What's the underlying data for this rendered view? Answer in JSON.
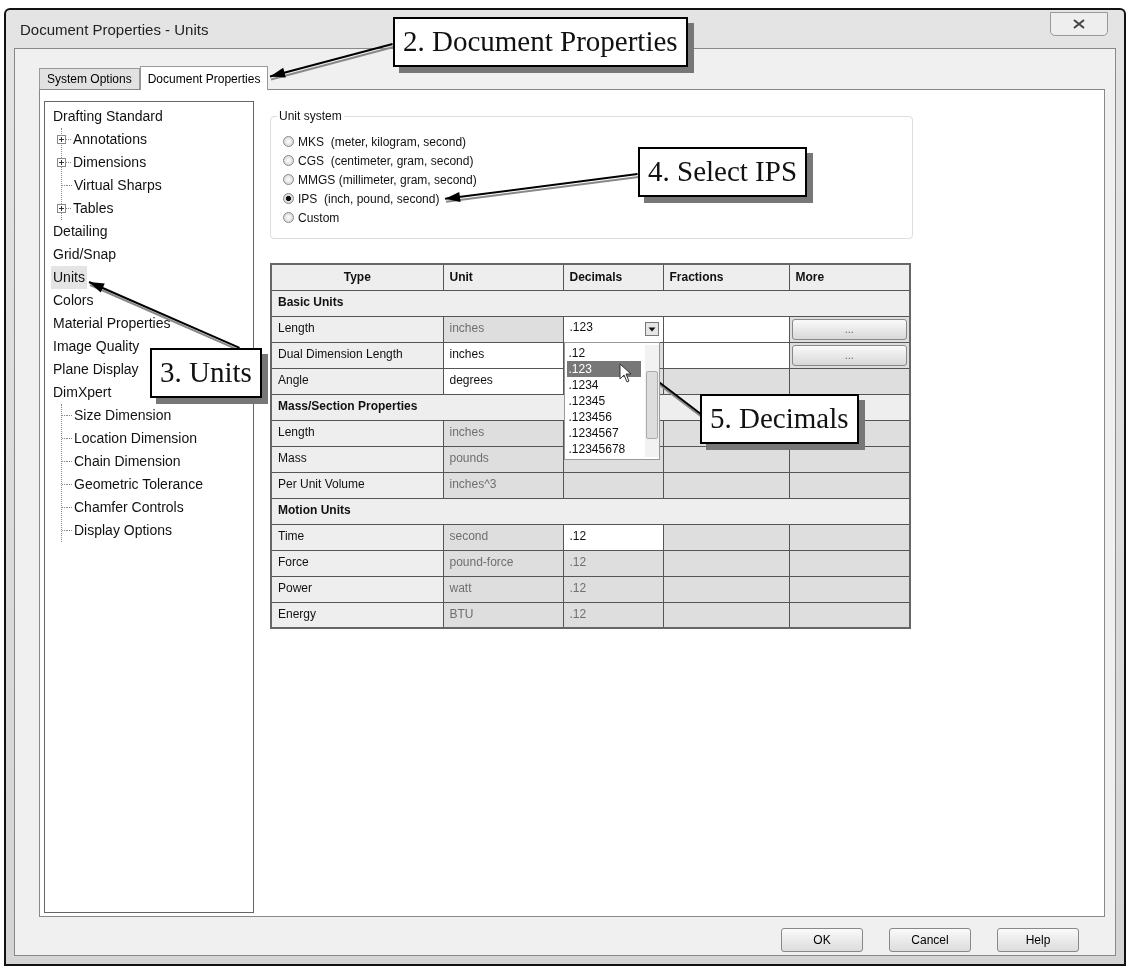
{
  "window": {
    "title": "Document Properties - Units"
  },
  "tabs": [
    {
      "label": "System Options",
      "selected": false
    },
    {
      "label": "Document Properties",
      "selected": true
    }
  ],
  "tree": [
    {
      "label": "Drafting Standard",
      "selected": false,
      "children": [
        {
          "label": "Annotations",
          "expandable": true,
          "selected": false
        },
        {
          "label": "Dimensions",
          "expandable": true,
          "selected": false
        },
        {
          "label": "Virtual Sharps",
          "expandable": false,
          "selected": false
        },
        {
          "label": "Tables",
          "expandable": true,
          "selected": false
        }
      ]
    },
    {
      "label": "Detailing",
      "selected": false
    },
    {
      "label": "Grid/Snap",
      "selected": false
    },
    {
      "label": "Units",
      "selected": true
    },
    {
      "label": "Colors",
      "selected": false
    },
    {
      "label": "Material Properties",
      "selected": false
    },
    {
      "label": "Image Quality",
      "selected": false
    },
    {
      "label": "Plane Display",
      "selected": false
    },
    {
      "label": "DimXpert",
      "selected": false,
      "children": [
        {
          "label": "Size Dimension",
          "expandable": false,
          "selected": false
        },
        {
          "label": "Location Dimension",
          "expandable": false,
          "selected": false
        },
        {
          "label": "Chain Dimension",
          "expandable": false,
          "selected": false
        },
        {
          "label": "Geometric Tolerance",
          "expandable": false,
          "selected": false
        },
        {
          "label": "Chamfer Controls",
          "expandable": false,
          "selected": false
        },
        {
          "label": "Display Options",
          "expandable": false,
          "selected": false
        }
      ]
    }
  ],
  "unit_system": {
    "legend": "Unit system",
    "options": [
      {
        "label": "MKS  (meter, kilogram, second)",
        "selected": false
      },
      {
        "label": "CGS  (centimeter, gram, second)",
        "selected": false
      },
      {
        "label": "MMGS (millimeter, gram, second)",
        "selected": false
      },
      {
        "label": "IPS  (inch, pound, second)",
        "selected": true
      },
      {
        "label": "Custom",
        "selected": false
      }
    ]
  },
  "table": {
    "columns": [
      "Type",
      "Unit",
      "Decimals",
      "Fractions",
      "More"
    ],
    "rows": [
      {
        "kind": "section",
        "label": "Basic Units"
      },
      {
        "kind": "row",
        "type": "Length",
        "unit": "inches",
        "unit_editable": false,
        "decimals_editable": true,
        "fractions_editable": true,
        "more": "...",
        "dropdown": {
          "value": ".123",
          "options": [
            {
              "label": ".12",
              "selected": false
            },
            {
              "label": ".123",
              "selected": true
            },
            {
              "label": ".1234",
              "selected": false
            },
            {
              "label": ".12345",
              "selected": false
            },
            {
              "label": ".123456",
              "selected": false
            },
            {
              "label": ".1234567",
              "selected": false
            },
            {
              "label": ".12345678",
              "selected": false
            }
          ]
        }
      },
      {
        "kind": "row",
        "type": "Dual Dimension Length",
        "unit": "inches",
        "unit_editable": true,
        "decimals_editable": false,
        "fractions_editable": true,
        "more": "..."
      },
      {
        "kind": "row",
        "type": "Angle",
        "unit": "degrees",
        "unit_editable": true,
        "decimals_editable": false,
        "fractions_editable": false
      },
      {
        "kind": "section",
        "label": "Mass/Section Properties"
      },
      {
        "kind": "row",
        "type": "Length",
        "unit": "inches",
        "unit_editable": false,
        "decimals_editable": false,
        "fractions_editable": false
      },
      {
        "kind": "row",
        "type": "Mass",
        "unit": "pounds",
        "unit_editable": false,
        "decimals_editable": false,
        "fractions_editable": false
      },
      {
        "kind": "row",
        "type": "Per Unit Volume",
        "unit": "inches^3",
        "unit_editable": false,
        "decimals_editable": false,
        "fractions_editable": false
      },
      {
        "kind": "section",
        "label": "Motion Units"
      },
      {
        "kind": "row",
        "type": "Time",
        "unit": "second",
        "unit_editable": false,
        "decimals": ".12",
        "decimals_editable": true,
        "fractions_editable": false
      },
      {
        "kind": "row",
        "type": "Force",
        "unit": "pound-force",
        "unit_editable": false,
        "decimals": ".12",
        "decimals_editable": false,
        "fractions_editable": false
      },
      {
        "kind": "row",
        "type": "Power",
        "unit": "watt",
        "unit_editable": false,
        "decimals": ".12",
        "decimals_editable": false,
        "fractions_editable": false
      },
      {
        "kind": "row",
        "type": "Energy",
        "unit": "BTU",
        "unit_editable": false,
        "decimals": ".12",
        "decimals_editable": false,
        "fractions_editable": false
      }
    ]
  },
  "buttons": [
    "OK",
    "Cancel",
    "Help"
  ],
  "callouts": [
    "2. Document Properties",
    "4. Select IPS",
    "3. Units",
    "5. Decimals"
  ]
}
